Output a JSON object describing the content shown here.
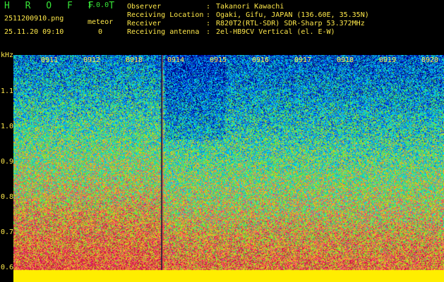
{
  "header": {
    "app_title": "H R O F F T",
    "version": "1.0.0",
    "filename": "2511200910.png",
    "timestamp": "25.11.20 09:10",
    "meteor_label": "meteor",
    "meteor_count": "0",
    "info": [
      {
        "key": "Observer",
        "sep": ":",
        "value": "Takanori Kawachi"
      },
      {
        "key": "Receiving Location",
        "sep": ":",
        "value": "Ogaki, Gifu, JAPAN (136.60E, 35.35N)"
      },
      {
        "key": "Receiver",
        "sep": ":",
        "value": "R820T2(RTL-SDR) SDR-Sharp 53.372MHz"
      },
      {
        "key": "Receiving antenna",
        "sep": ":",
        "value": "2el-HB9CV Vertical (el. E-W)"
      }
    ]
  },
  "axis": {
    "unit": "kHz",
    "y_ticks": [
      "1.1",
      "1.0",
      "0.9",
      "0.8",
      "0.7",
      "0.6"
    ],
    "time_labels": [
      "0911",
      "0912",
      "0918",
      "0914",
      "0915",
      "0916",
      "0917",
      "0918",
      "0919",
      "0920"
    ]
  },
  "colors": {
    "title_green": "#37e437",
    "label_yellow": "#ffe94a",
    "baseline_yellow": "#ffee00"
  }
}
